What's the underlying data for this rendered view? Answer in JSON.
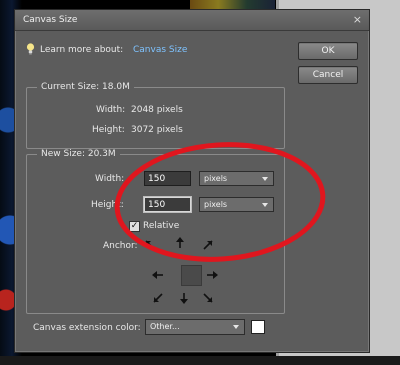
{
  "dialog": {
    "title": "Canvas Size",
    "close_glyph": "×",
    "learn_more_label": "Learn more about:",
    "learn_more_link": "Canvas Size",
    "ok_label": "OK",
    "cancel_label": "Cancel"
  },
  "current_size": {
    "legend": "Current Size: 18.0M",
    "width_label": "Width:",
    "width_value": "2048 pixels",
    "height_label": "Height:",
    "height_value": "3072 pixels"
  },
  "new_size": {
    "legend": "New Size: 20.3M",
    "width_label": "Width:",
    "width_value": "150",
    "width_unit": "pixels",
    "height_label": "Height:",
    "height_value": "150",
    "height_unit": "pixels",
    "relative_label": "Relative",
    "relative_checked": true,
    "check_glyph": "✓",
    "anchor_label": "Anchor:"
  },
  "extension": {
    "label": "Canvas extension color:",
    "selected": "Other...",
    "swatch_color": "#ffffff"
  },
  "colors": {
    "dialog_bg": "#5c5c5c",
    "link": "#7fc3ff",
    "annotation": "#e0161e"
  },
  "icons": [
    "lightbulb-icon",
    "close-icon",
    "dropdown-arrow-icon",
    "checkmark-icon",
    "anchor-arrow-icon"
  ]
}
